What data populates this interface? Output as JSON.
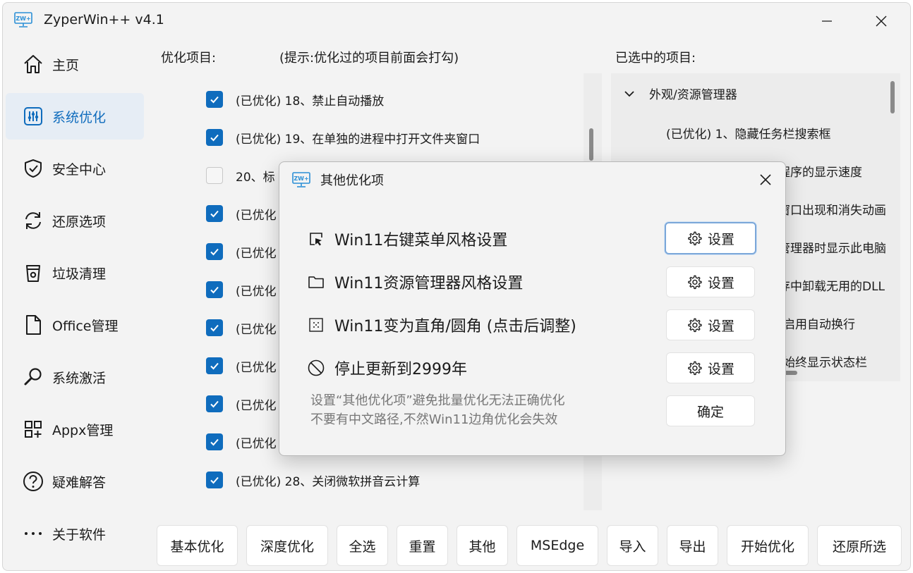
{
  "window": {
    "title": "ZyperWin++ v4.1",
    "logo_text": "ZW+"
  },
  "sidebar": {
    "items": [
      {
        "label": "主页",
        "icon": "home-icon",
        "active": false
      },
      {
        "label": "系统优化",
        "icon": "sliders-icon",
        "active": true
      },
      {
        "label": "安全中心",
        "icon": "shield-icon",
        "active": false
      },
      {
        "label": "还原选项",
        "icon": "refresh-icon",
        "active": false
      },
      {
        "label": "垃圾清理",
        "icon": "trash-icon",
        "active": false
      },
      {
        "label": "Office管理",
        "icon": "document-icon",
        "active": false
      },
      {
        "label": "系统激活",
        "icon": "key-icon",
        "active": false
      },
      {
        "label": "Appx管理",
        "icon": "apps-icon",
        "active": false
      },
      {
        "label": "疑难解答",
        "icon": "help-icon",
        "active": false
      },
      {
        "label": "关于软件",
        "icon": "more-icon",
        "active": false
      }
    ]
  },
  "main": {
    "options_header": "优化项目:",
    "hint": "(提示:优化过的项目前面会打勾)",
    "selected_header": "已选中的项目:",
    "options": [
      {
        "label": "(已优化) 18、禁止自动播放",
        "checked": true
      },
      {
        "label": "(已优化) 19、在单独的进程中打开文件夹窗口",
        "checked": true
      },
      {
        "label": "20、标",
        "checked": false
      },
      {
        "label": "(已优化",
        "checked": true
      },
      {
        "label": "(已优化",
        "checked": true
      },
      {
        "label": "(已优化",
        "checked": true
      },
      {
        "label": "(已优化",
        "checked": true
      },
      {
        "label": "(已优化",
        "checked": true
      },
      {
        "label": "(已优化",
        "checked": true
      },
      {
        "label": "(已优化",
        "checked": true
      },
      {
        "label": "(已优化) 28、关闭微软拼音云计算",
        "checked": true
      }
    ],
    "selected_tree": {
      "group": "外观/资源管理器",
      "items": [
        "(已优化) 1、隐藏任务栏搜索框",
        "合程序的显示速度",
        "示窗口出现和消失动画",
        "源管理器时显示此电脑",
        "内存中卸载无用的DLL",
        "启用自动换行",
        "始终显示状态栏"
      ]
    }
  },
  "toolbar": {
    "buttons": [
      "基本优化",
      "深度优化",
      "全选",
      "重置",
      "其他",
      "MSEdge",
      "导入",
      "导出",
      "开始优化",
      "还原所选"
    ]
  },
  "dialog": {
    "title": "其他优化项",
    "rows": [
      {
        "label": "Win11右键菜单风格设置",
        "icon": "cursor-box-icon",
        "button": "设置"
      },
      {
        "label": "Win11资源管理器风格设置",
        "icon": "folder-icon",
        "button": "设置"
      },
      {
        "label": "Win11变为直角/圆角 (点击后调整)",
        "icon": "dotted-square-icon",
        "button": "设置"
      },
      {
        "label": "停止更新到2999年",
        "icon": "block-icon",
        "button": "设置"
      }
    ],
    "note_line1": "设置“其他优化项”避免批量优化无法正确优化",
    "note_line2": "不要有中文路径,不然Win11边角优化会失效",
    "confirm": "确定"
  },
  "colors": {
    "accent": "#0f6cbd",
    "active_nav": "#e6edf5",
    "logo": "#2b8fd6"
  }
}
